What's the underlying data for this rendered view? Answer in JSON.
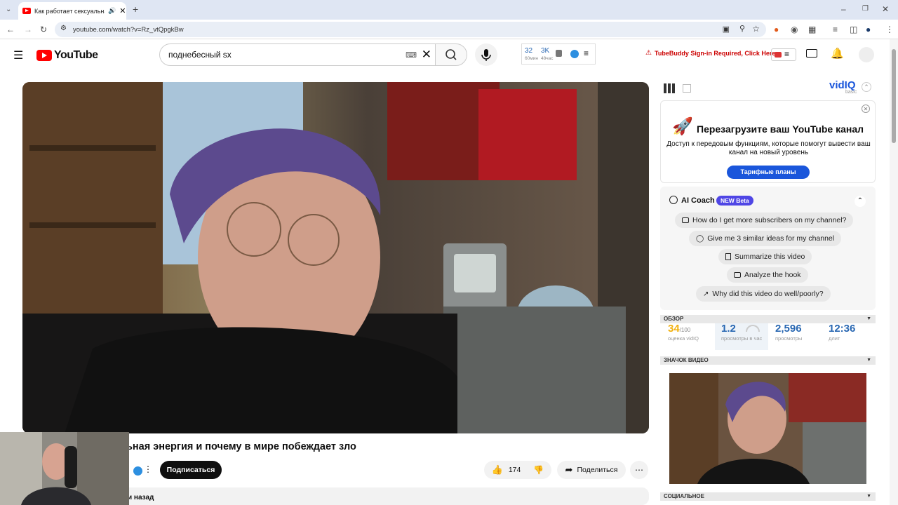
{
  "browser": {
    "tab_title": "Как работает сексуальная",
    "url": "youtube.com/watch?v=Rz_vtQpgkBw"
  },
  "youtube": {
    "logo_text": "YouTube",
    "search_value": "поднебесный sx",
    "stats": {
      "views_60m": "32",
      "views_60m_label": "60мин",
      "views_48h": "3K",
      "views_48h_label": "48час"
    },
    "tubebuddy_text": "TubeBuddy Sign-in Required, Click Here"
  },
  "video": {
    "title_visible": "ьная энергия и почему в мире побеждает зло",
    "subscribe_label": "Подписаться",
    "likes": "174",
    "share_label": "Поделиться",
    "description_date_fragment": "и назад"
  },
  "vidiq": {
    "logo": "vidIQ",
    "logo_sub": "basic",
    "promo_title": "Перезагрузите ваш YouTube канал",
    "promo_text": "Доступ к передовым функциям, которые помогут вывести ваш канал на новый уровень",
    "promo_button": "Тарифные планы",
    "ai_coach_title": "AI Coach",
    "ai_coach_badge": "NEW Beta",
    "questions": [
      "How do I get more subscribers on my channel?",
      "Give me 3 similar ideas for my channel",
      "Summarize this video",
      "Analyze the hook",
      "Why did this video do well/poorly?"
    ],
    "overview_header": "ОБЗОР",
    "score": "34",
    "score_max": "/100",
    "score_label": "оценка vidIQ",
    "vph": "1.2",
    "vph_label": "просмотры в час",
    "views": "2,596",
    "views_label": "просмотры",
    "length": "12:36",
    "length_label": "длит",
    "thumbnail_header": "ЗНАЧОК ВИДЕО",
    "social_header": "СОЦИАЛЬНОЕ"
  },
  "colors": {
    "youtube_red": "#ff0000",
    "vidiq_blue": "#1a56db",
    "score_yellow": "#f2b10f",
    "stat_blue": "#2867b2",
    "tubebuddy_red": "#cc0000"
  }
}
